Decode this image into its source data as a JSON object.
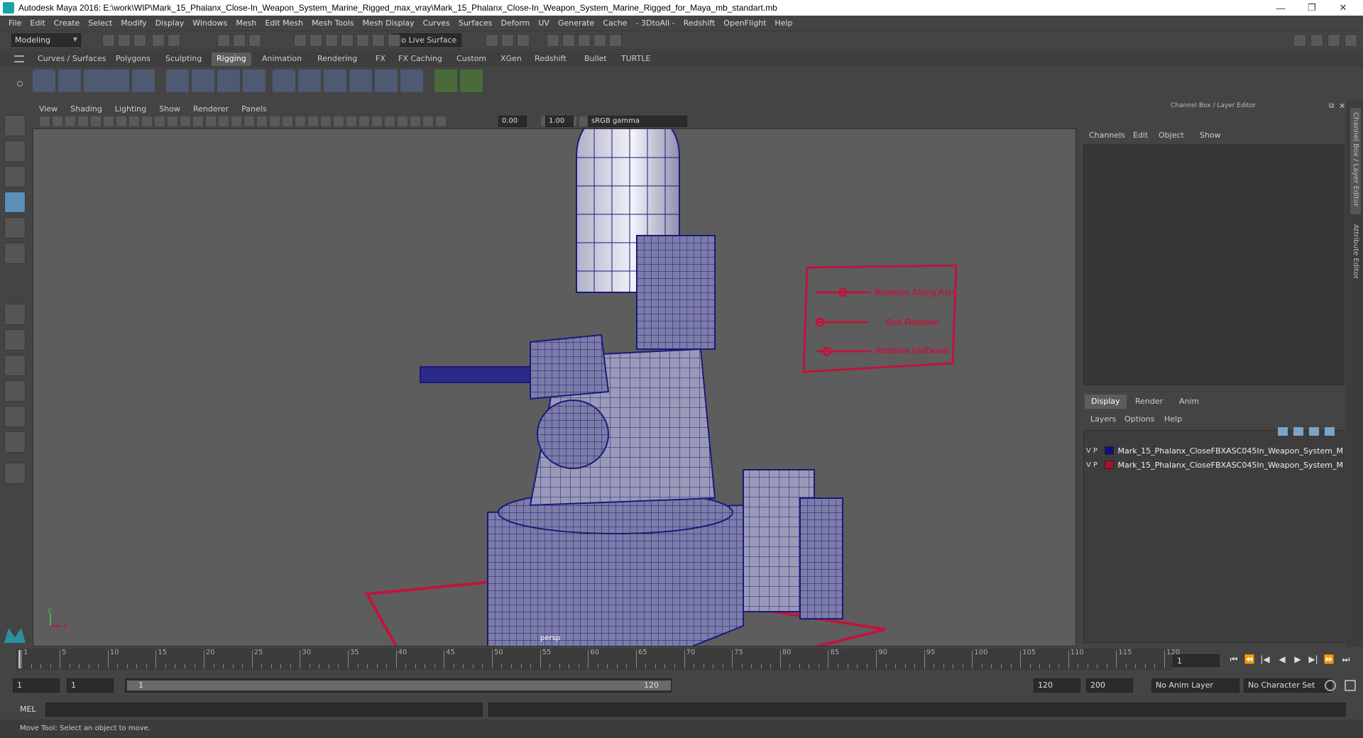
{
  "window": {
    "title": "Autodesk Maya 2016: E:\\work\\WIP\\Mark_15_Phalanx_Close-In_Weapon_System_Marine_Rigged_max_vray\\Mark_15_Phalanx_Close-In_Weapon_System_Marine_Rigged_for_Maya_mb_standart.mb",
    "minimize": "—",
    "restore": "❐",
    "close": "✕"
  },
  "menubar": [
    "File",
    "Edit",
    "Create",
    "Select",
    "Modify",
    "Display",
    "Windows",
    "Mesh",
    "Edit Mesh",
    "Mesh Tools",
    "Mesh Display",
    "Curves",
    "Surfaces",
    "Deform",
    "UV",
    "Generate",
    "Cache",
    "- 3DtoAll -",
    "Redshift",
    "OpenFlight",
    "Help"
  ],
  "statusline": {
    "mode": "Modeling",
    "live_surface": "No Live Surface"
  },
  "shelf_tabs": [
    "Curves / Surfaces",
    "Polygons",
    "Sculpting",
    "Rigging",
    "Animation",
    "Rendering",
    "FX",
    "FX Caching",
    "Custom",
    "XGen",
    "Redshift",
    "Bullet",
    "TURTLE"
  ],
  "active_shelf": "Rigging",
  "viewport": {
    "menu": [
      "View",
      "Shading",
      "Lighting",
      "Show",
      "Renderer",
      "Panels"
    ],
    "exposure": "0.00",
    "gamma": "1.00",
    "color_space": "sRGB gamma",
    "camera_label": "persp",
    "axis": {
      "y": "y",
      "x": "x"
    },
    "controls": [
      "Rotation Along Axis",
      "Gun Rotation",
      "Rotation Up/Down"
    ]
  },
  "colors": {
    "wire": "#1a1a7a",
    "rig": "#c0143c",
    "accent": "#5a8fb8"
  },
  "channel_box": {
    "title": "Channel Box / Layer Editor",
    "menu": [
      "Channels",
      "Edit",
      "Object",
      "Show"
    ]
  },
  "layer_editor": {
    "tabs": [
      "Display",
      "Render",
      "Anim"
    ],
    "active_tab": "Display",
    "menu": [
      "Layers",
      "Options",
      "Help"
    ],
    "layers": [
      {
        "v": "V",
        "p": "P",
        "color": "#0f0f7a",
        "name": "Mark_15_Phalanx_CloseFBXASC045In_Weapon_System_M"
      },
      {
        "v": "V",
        "p": "P",
        "color": "#b01030",
        "name": "Mark_15_Phalanx_CloseFBXASC045In_Weapon_System_M"
      }
    ]
  },
  "side_tabs": [
    "Channel Box / Layer Editor",
    "Attribute Editor"
  ],
  "timeline": {
    "ticks": [
      "1",
      "5",
      "10",
      "15",
      "20",
      "25",
      "30",
      "35",
      "40",
      "45",
      "50",
      "55",
      "60",
      "65",
      "70",
      "75",
      "80",
      "85",
      "90",
      "95",
      "100",
      "105",
      "110",
      "115",
      "120"
    ],
    "current_frame": "1"
  },
  "range": {
    "start": "1",
    "playback_start": "1",
    "slider_start": "1",
    "slider_end": "120",
    "playback_end": "120",
    "end": "200",
    "anim_layer": "No Anim Layer",
    "character_set": "No Character Set"
  },
  "mel": {
    "label": "MEL"
  },
  "help_line": "Move Tool: Select an object to move."
}
